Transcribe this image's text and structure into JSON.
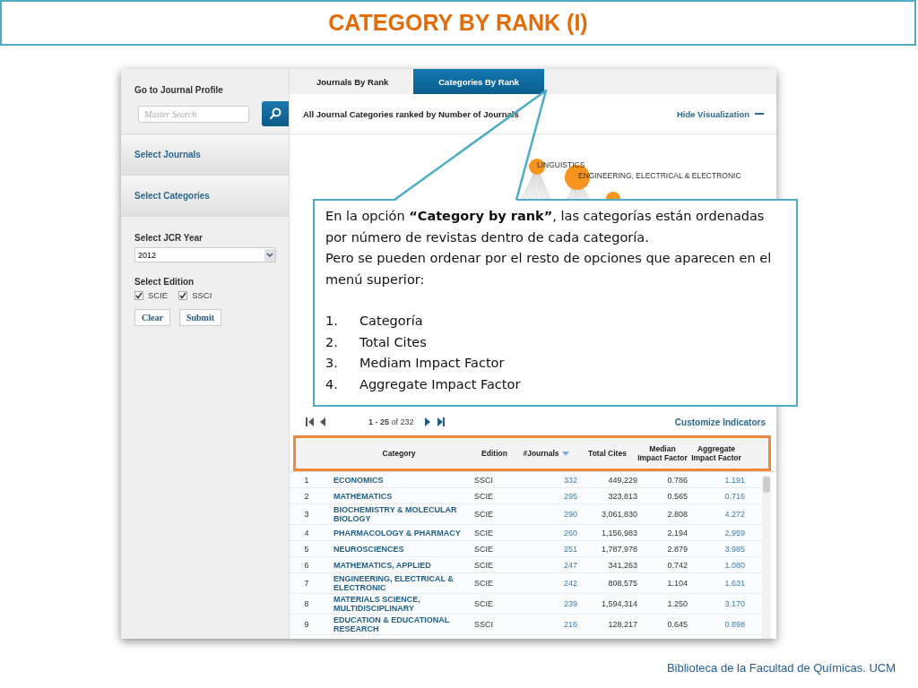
{
  "title": "CATEGORY BY RANK (I)",
  "sidebar": {
    "profile_label": "Go to Journal Profile",
    "search": {
      "placeholder": "Master Search"
    },
    "sections": [
      {
        "label": "Select Journals"
      },
      {
        "label": "Select Categories"
      }
    ],
    "year_label": "Select JCR Year",
    "year": "2012",
    "edition_label": "Select Edition",
    "editions": [
      {
        "label": "SCIE",
        "checked": true
      },
      {
        "label": "SSCI",
        "checked": true
      }
    ],
    "buttons": [
      "Clear",
      "Submit"
    ]
  },
  "tabs": [
    {
      "label": "Journals By Rank",
      "selected": false
    },
    {
      "label": "Categories By Rank",
      "selected": true
    }
  ],
  "heading": "All Journal Categories ranked by Number of Journals",
  "hide_link": "Hide Visualization",
  "visualization": {
    "labels": [
      "LINGUISTICS",
      "ENGINEERING, ELECTRICAL & ELECTRONIC"
    ]
  },
  "pager": "**1 - 25** of 232",
  "customize": "Customize Indicators",
  "table": {
    "columns": [
      {
        "label": "Category",
        "sorted": false
      },
      {
        "label": "Edition",
        "sorted": false
      },
      {
        "label": "#Journals",
        "sorted": true
      },
      {
        "label": "Total Cites",
        "sorted": false
      },
      {
        "label": "Median Impact Factor",
        "sorted": false
      },
      {
        "label": "Aggregate Impact Factor",
        "sorted": false
      }
    ],
    "rows": [
      {
        "rank": "1",
        "category": "ECONOMICS",
        "edition": "SSCI",
        "journals": "332",
        "total_cites": "449,229",
        "median": "0.786",
        "aggregate": "1.191"
      },
      {
        "rank": "2",
        "category": "MATHEMATICS",
        "edition": "SCIE",
        "journals": "295",
        "total_cites": "323,813",
        "median": "0.565",
        "aggregate": "0.716"
      },
      {
        "rank": "3",
        "category": "BIOCHEMISTRY & MOLECULAR BIOLOGY",
        "edition": "SCIE",
        "journals": "290",
        "total_cites": "3,061,830",
        "median": "2.808",
        "aggregate": "4.272"
      },
      {
        "rank": "4",
        "category": "PHARMACOLOGY & PHARMACY",
        "edition": "SCIE",
        "journals": "260",
        "total_cites": "1,156,983",
        "median": "2.194",
        "aggregate": "2.959"
      },
      {
        "rank": "5",
        "category": "NEUROSCIENCES",
        "edition": "SCIE",
        "journals": "251",
        "total_cites": "1,787,978",
        "median": "2.879",
        "aggregate": "3.985"
      },
      {
        "rank": "6",
        "category": "MATHEMATICS, APPLIED",
        "edition": "SCIE",
        "journals": "247",
        "total_cites": "341,263",
        "median": "0.742",
        "aggregate": "1.080"
      },
      {
        "rank": "7",
        "category": "ENGINEERING, ELECTRICAL & ELECTRONIC",
        "edition": "SCIE",
        "journals": "242",
        "total_cites": "808,575",
        "median": "1.104",
        "aggregate": "1.631"
      },
      {
        "rank": "8",
        "category": "MATERIALS SCIENCE, MULTIDISCIPLINARY",
        "edition": "SCIE",
        "journals": "239",
        "total_cites": "1,594,314",
        "median": "1.250",
        "aggregate": "3.170"
      },
      {
        "rank": "9",
        "category": "EDUCATION & EDUCATIONAL RESEARCH",
        "edition": "SSCI",
        "journals": "216",
        "total_cites": "128,217",
        "median": "0.645",
        "aggregate": "0.898"
      }
    ]
  },
  "callout": {
    "paragraphs": [
      "En la opción **“Category by rank”**, las categorías están ordenadas por número de revistas dentro de cada categoría.",
      "Pero se pueden ordenar por el resto de opciones que aparecen en el menú superior:"
    ],
    "list": [
      {
        "number": "1.",
        "text": "Categoría"
      },
      {
        "number": "2.",
        "text": "Total Cites"
      },
      {
        "number": "3.",
        "text": "Mediam Impact Factor"
      },
      {
        "number": "4.",
        "text": "Aggregate Impact Factor"
      }
    ]
  },
  "footer": "Biblioteca de la Facultad de Químicas. UCM"
}
